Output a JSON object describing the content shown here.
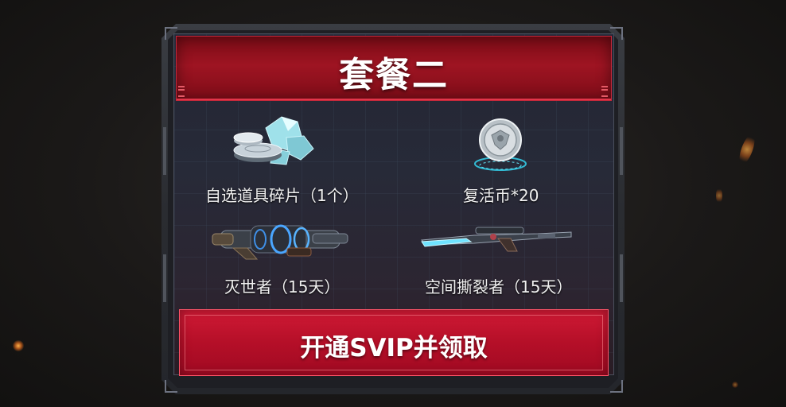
{
  "package": {
    "title": "套餐二"
  },
  "rewards": [
    {
      "label": "自选道具碎片（1个）",
      "icon": "item-fragments-icon"
    },
    {
      "label": "复活币*20",
      "icon": "revive-coin-icon"
    },
    {
      "label": "灭世者（15天）",
      "icon": "heavy-gun-icon"
    },
    {
      "label": "空间撕裂者（15天）",
      "icon": "sniper-rifle-icon"
    }
  ],
  "claim_button": {
    "label": "开通SVIP并领取"
  },
  "colors": {
    "accent_red": "#b50f28",
    "title_red": "#9e1422",
    "frame_gray": "#2a2c31"
  }
}
